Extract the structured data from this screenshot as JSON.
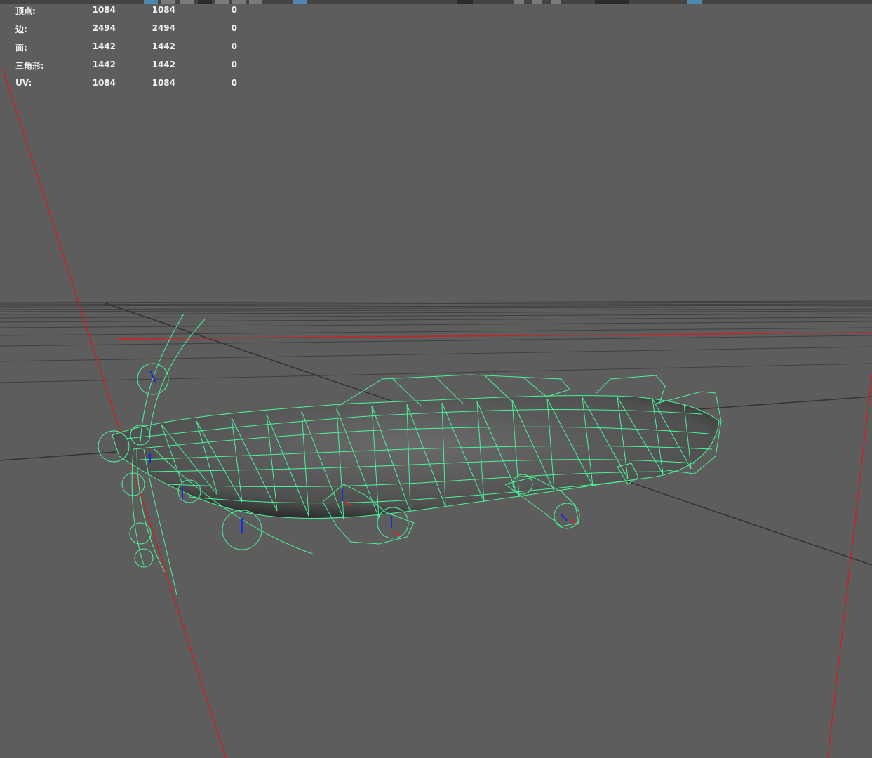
{
  "viewport": {
    "background": "#5d5d5d",
    "mesh_color": "#4cf29a",
    "camera_frustum_color": "#d42020",
    "grid_color": "#3d3d3d",
    "axis_line_color": "#333333"
  },
  "toolbar": {
    "icons": [
      "select-icon",
      "lasso-icon",
      "paint-icon",
      "move-icon",
      "rotate-icon",
      "scale-icon",
      "snap-grid-icon",
      "snap-curve-icon",
      "snap-point-icon",
      "render-icon",
      "ipr-icon",
      "render-settings-icon",
      "camera-icon"
    ]
  },
  "poly_count": {
    "rows": [
      {
        "label": "顶点:",
        "v1": "1084",
        "v2": "1084",
        "v3": "0"
      },
      {
        "label": "边:",
        "v1": "2494",
        "v2": "2494",
        "v3": "0"
      },
      {
        "label": "面:",
        "v1": "1442",
        "v2": "1442",
        "v3": "0"
      },
      {
        "label": "三角形:",
        "v1": "1442",
        "v2": "1442",
        "v3": "0"
      },
      {
        "label": "UV:",
        "v1": "1084",
        "v2": "1084",
        "v3": "0"
      }
    ]
  }
}
